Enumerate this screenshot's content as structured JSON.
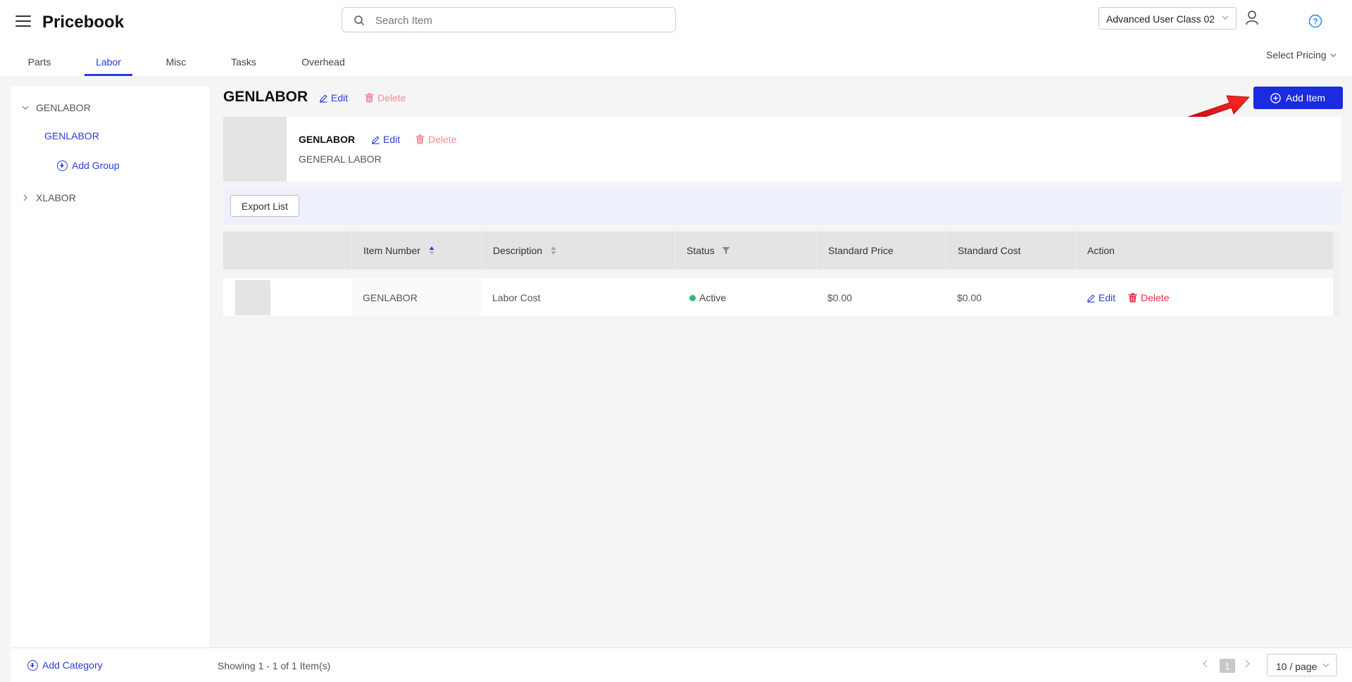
{
  "app": {
    "title": "Pricebook"
  },
  "search": {
    "placeholder": "Search Item"
  },
  "header": {
    "user_class": "Advanced User Class 02",
    "select_pricing": "Select Pricing"
  },
  "tabs": [
    {
      "label": "Parts",
      "active": false
    },
    {
      "label": "Labor",
      "active": true
    },
    {
      "label": "Misc",
      "active": false
    },
    {
      "label": "Tasks",
      "active": false
    },
    {
      "label": "Overhead",
      "active": false
    }
  ],
  "sidebar": {
    "categories": [
      {
        "label": "GENLABOR",
        "expanded": true,
        "groups": [
          {
            "label": "GENLABOR",
            "selected": true
          }
        ]
      },
      {
        "label": "XLABOR",
        "expanded": false,
        "groups": []
      }
    ],
    "add_group": "Add Group",
    "add_category": "Add Category"
  },
  "category": {
    "title": "GENLABOR",
    "edit": "Edit",
    "delete": "Delete"
  },
  "add_item": "Add Item",
  "group": {
    "name": "GENLABOR",
    "description": "GENERAL LABOR",
    "edit": "Edit",
    "delete": "Delete"
  },
  "export_list": "Export List",
  "table": {
    "headers": [
      "Item Number",
      "Description",
      "Status",
      "Standard Price",
      "Standard Cost",
      "Action"
    ],
    "rows": [
      {
        "item_number": "GENLABOR",
        "description": "Labor Cost",
        "status": "Active",
        "standard_price": "$0.00",
        "standard_cost": "$0.00",
        "edit": "Edit",
        "delete": "Delete"
      }
    ]
  },
  "pagination": {
    "showing": "Showing 1 - 1 of 1 Item(s)",
    "current_page": "1",
    "page_size": "10 / page"
  },
  "colors": {
    "accent": "#2c3cd8",
    "primary_button": "#1a2be0",
    "danger": "#e8314a",
    "status_active": "#2dbd6e",
    "annotation_arrow": "#e01a1a"
  },
  "icons": [
    "menu-icon",
    "search-icon",
    "user-icon",
    "help-icon",
    "chevron-down-icon",
    "plus-circle-icon",
    "edit-icon",
    "trash-icon",
    "sort-icon",
    "filter-icon",
    "chevron-left-icon",
    "chevron-right-icon"
  ]
}
